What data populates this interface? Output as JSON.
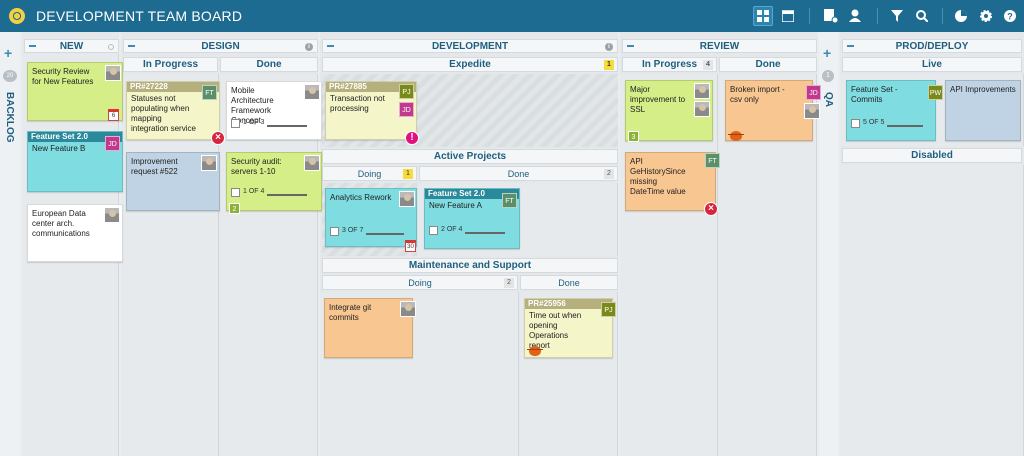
{
  "app": {
    "title": "DEVELOPMENT TEAM BOARD"
  },
  "colors": {
    "header": "#1d6b90",
    "yellow": "#f4f5c9",
    "green": "#d5ee87",
    "cyan": "#7fdde2",
    "blue": "#bfd3e4",
    "orange": "#f8c691",
    "white": "#ffffff"
  },
  "toolbar": {
    "icons": [
      "board-view-icon",
      "calendar-icon",
      "add-card-icon",
      "add-user-icon",
      "filter-icon",
      "search-icon",
      "chart-icon",
      "gear-icon",
      "help-icon"
    ]
  },
  "backlog": {
    "label": "BACKLOG",
    "count": "20"
  },
  "qa": {
    "label": "QA",
    "count": "1"
  },
  "columns": {
    "new": "NEW",
    "design": "DESIGN",
    "development": "DEVELOPMENT",
    "review": "REVIEW",
    "prod": "PROD/DEPLOY"
  },
  "sub": {
    "design_inprogress": "In Progress",
    "design_done": "Done",
    "expedite": "Expedite",
    "expedite_count": "1",
    "active": "Active Projects",
    "doing": "Doing",
    "doing_count": "1",
    "done": "Done",
    "done_count": "2",
    "maint": "Maintenance and Support",
    "maint_doing": "Doing",
    "maint_count": "2",
    "maint_done": "Done",
    "review_inprogress": "In Progress",
    "review_count": "4",
    "review_done": "Done",
    "live": "Live",
    "disabled": "Disabled"
  },
  "cards": {
    "c1": {
      "text": "Security Review for New Features",
      "date": "6"
    },
    "c2": {
      "pr": "Feature Set 2.0",
      "text": "New Feature B",
      "badge": "JD"
    },
    "c3": {
      "text": "European Data center arch. communications"
    },
    "c4": {
      "pr": "PR#27228",
      "text": "Statuses not populating when mapping integration service",
      "badge": "FT"
    },
    "c5": {
      "text": "Improvement request #522"
    },
    "c6": {
      "text": "Mobile Architecture Framework Concept",
      "prog": "1 OF 3"
    },
    "c7": {
      "text": "Security audit: servers 1-10",
      "prog": "1 OF 4",
      "num": "2"
    },
    "c8": {
      "pr": "PR#27885",
      "text": "Transaction not processing",
      "badge": "PJ",
      "badge2": "JD"
    },
    "c9": {
      "text": "Analytics Rework",
      "prog": "3 OF 7",
      "date": "30"
    },
    "c10": {
      "pr": "Feature Set 2.0",
      "text": "New Feature A",
      "badge": "FT",
      "prog": "2 OF 4"
    },
    "c11": {
      "text": "Integrate git commits"
    },
    "c12": {
      "pr": "PR#25956",
      "text": "Time out when opening Operations report",
      "badge": "PJ"
    },
    "c13": {
      "text": "Major improvement to SSL",
      "num": "3"
    },
    "c14": {
      "text": "API GeHistorySince missing DateTime value",
      "badge": "FT"
    },
    "c15": {
      "text": "Broken import - csv only",
      "badge": "JD"
    },
    "c16": {
      "text": "Feature Set - Commits",
      "badge": "PW",
      "prog": "5 OF 5"
    },
    "c17": {
      "text": "API Improvements"
    }
  }
}
